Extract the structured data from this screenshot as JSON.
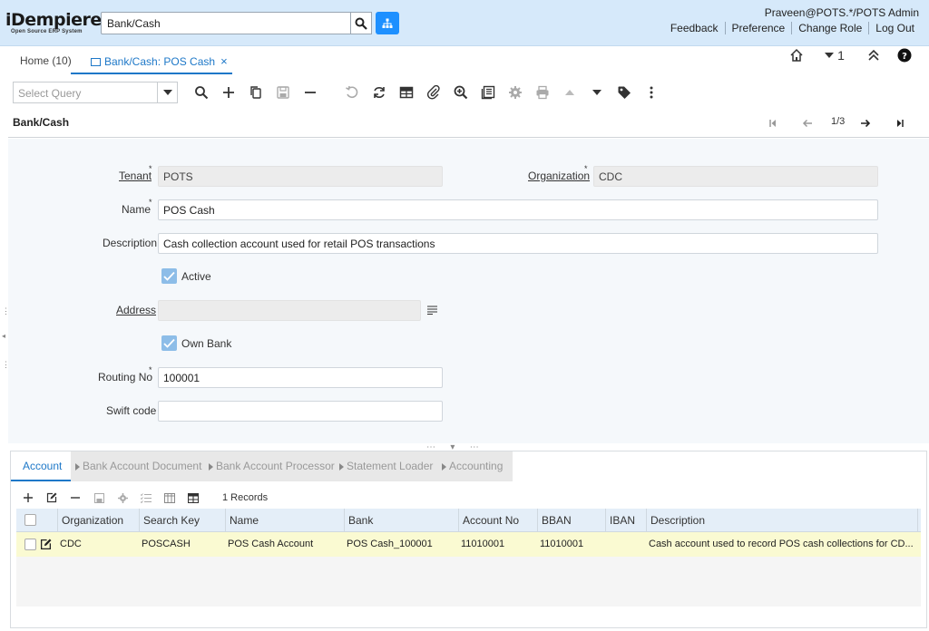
{
  "header": {
    "logo_main": "iDempiere",
    "logo_sub": "Open Source ERP System",
    "search_value": "Bank/Cash",
    "user": "Praveen@POTS.*/POTS Admin",
    "links": [
      "Feedback",
      "Preference",
      "Change Role",
      "Log Out"
    ]
  },
  "tabs": {
    "home": "Home (10)",
    "active": "Bank/Cash: POS Cash",
    "close": "×",
    "right_count": "1"
  },
  "toolbar": {
    "query_placeholder": "Select Query"
  },
  "title_bar": {
    "title": "Bank/Cash",
    "record_position": "1/3"
  },
  "form": {
    "tenant_label": "Tenant",
    "tenant_value": "POTS",
    "organization_label": "Organization",
    "organization_value": "CDC",
    "name_label": "Name",
    "name_value": "POS Cash",
    "description_label": "Description",
    "description_value": "Cash collection account used for retail POS transactions",
    "active_label": "Active",
    "active_checked": true,
    "address_label": "Address",
    "address_value": "",
    "own_bank_label": "Own Bank",
    "own_bank_checked": true,
    "routing_label": "Routing No",
    "routing_value": "100001",
    "swift_label": "Swift code",
    "swift_value": "",
    "required_mark": "*"
  },
  "detail": {
    "tabs": [
      "Account",
      "Bank Account Document",
      "Bank Account Processor",
      "Statement Loader",
      "Accounting"
    ],
    "records": "1 Records",
    "columns": [
      "Organization",
      "Search Key",
      "Name",
      "Bank",
      "Account No",
      "BBAN",
      "IBAN",
      "Description"
    ],
    "rows": [
      {
        "organization": "CDC",
        "search_key": "POSCASH",
        "name": "POS Cash Account",
        "bank": "POS Cash_100001",
        "account_no": "11010001",
        "bban": "11010001",
        "iban": "",
        "description": "Cash account used to record POS cash collections for CD..."
      }
    ]
  },
  "colors": {
    "header_bg": "#d6e9fa",
    "accent": "#1e78c8",
    "sitemap_btn": "#1e90ff",
    "checkbox": "#8dbde8",
    "row_highlight": "#fafad2"
  }
}
